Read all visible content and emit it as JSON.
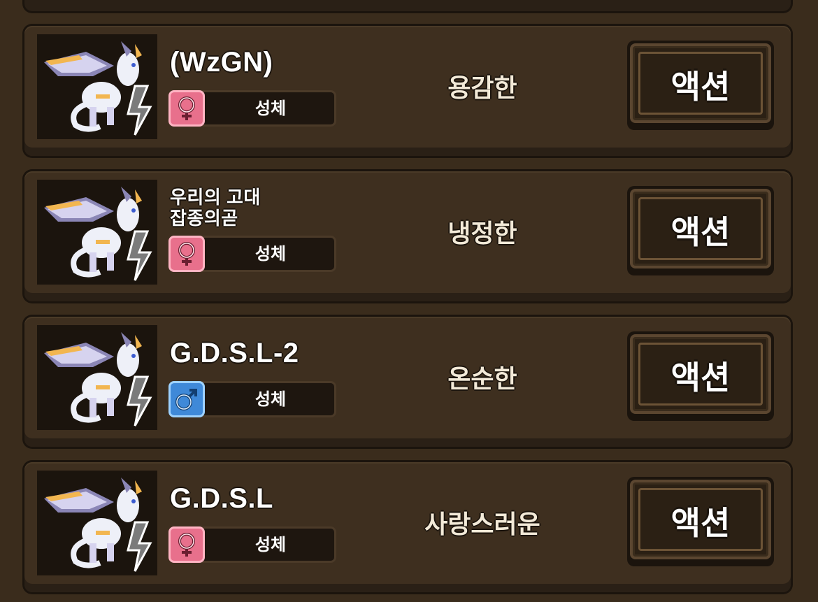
{
  "cards": [
    {
      "name": "(WzGN)",
      "gender": "female",
      "gender_icon": "female-icon",
      "stage": "성체",
      "personality": "용감한",
      "action_label": "액션"
    },
    {
      "name": "우리의 고대\n잡종의곧",
      "name_line1": "우리의 고대",
      "name_line2": "잡종의곧",
      "gender": "female",
      "gender_icon": "female-icon",
      "stage": "성체",
      "personality": "냉정한",
      "action_label": "액션"
    },
    {
      "name": "G.D.S.L-2",
      "gender": "male",
      "gender_icon": "male-icon",
      "stage": "성체",
      "personality": "온순한",
      "action_label": "액션"
    },
    {
      "name": "G.D.S.L",
      "gender": "female",
      "gender_icon": "female-icon",
      "stage": "성체",
      "personality": "사랑스러운",
      "action_label": "액션"
    }
  ],
  "colors": {
    "background": "#3a2c1c",
    "card": "#3e2f1f",
    "female": "#e8708c",
    "male": "#3f89d8"
  }
}
